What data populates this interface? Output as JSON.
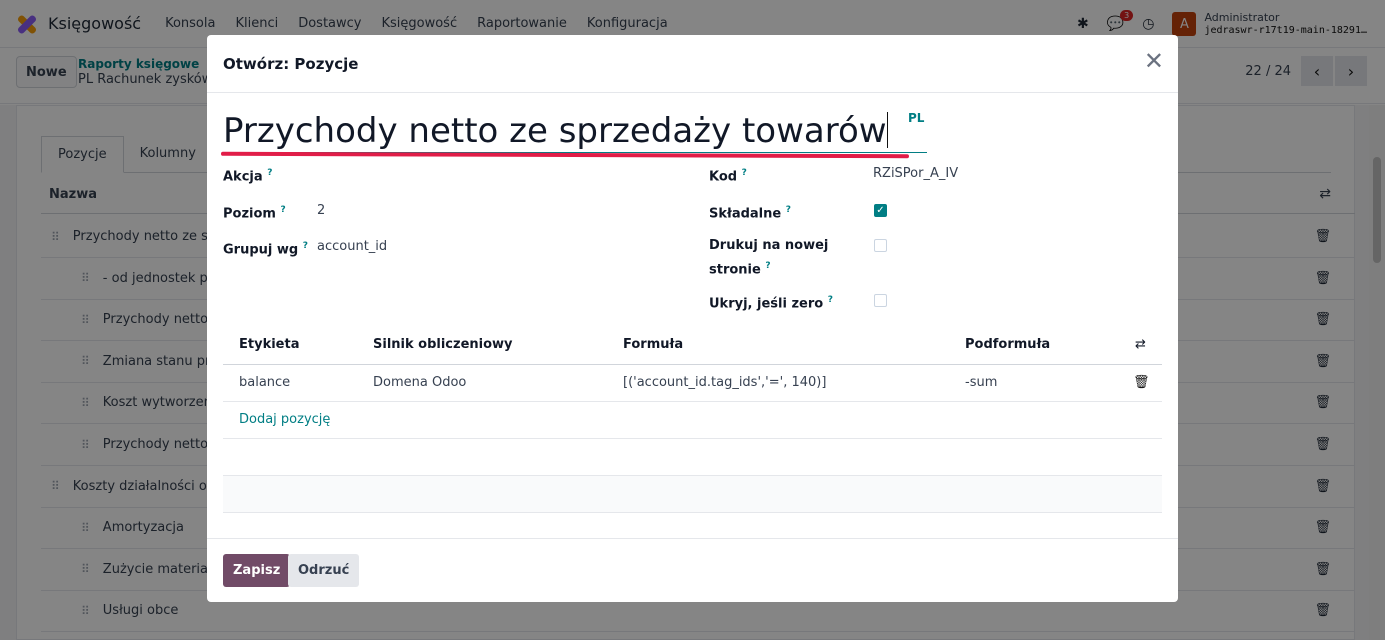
{
  "navbar": {
    "app_name": "Księgowość",
    "menu": [
      "Konsola",
      "Klienci",
      "Dostawcy",
      "Księgowość",
      "Raportowanie",
      "Konfiguracja"
    ],
    "messages_badge": "3",
    "avatar_letter": "A",
    "user_name": "Administrator",
    "db_name": "jedraswr-r17t19-main-18291…"
  },
  "control": {
    "new_label": "Nowe",
    "breadcrumb_parent": "Raporty księgowe",
    "breadcrumb_current": "PL Rachunek zysków",
    "pager": "22 / 24"
  },
  "background": {
    "tabs": [
      "Pozycje",
      "Kolumny"
    ],
    "column_name": "Nazwa",
    "rows": [
      {
        "label": "Przychody netto ze sp",
        "level": 1
      },
      {
        "label": "- od jednostek p",
        "level": 2
      },
      {
        "label": "Przychody netto",
        "level": 2
      },
      {
        "label": "Zmiana stanu pr",
        "level": 2
      },
      {
        "label": "Koszt wytworzen",
        "level": 2
      },
      {
        "label": "Przychody netto",
        "level": 2
      },
      {
        "label": "Koszty działalności op",
        "level": 1
      },
      {
        "label": "Amortyzacja",
        "level": 2
      },
      {
        "label": "Zużycie materia",
        "level": 2
      },
      {
        "label": "Usługi obce",
        "level": 2
      }
    ]
  },
  "modal": {
    "title": "Otwórz: Pozycje",
    "name_value": "Przychody netto ze sprzedaży towarów",
    "lang": "PL",
    "fields": {
      "akcja_label": "Akcja",
      "poziom_label": "Poziom",
      "poziom_value": "2",
      "grupuj_label": "Grupuj wg",
      "grupuj_value": "account_id",
      "kod_label": "Kod",
      "kod_value": "RZiSPor_A_IV",
      "skladalne_label": "Składalne",
      "skladalne_checked": true,
      "drukuj_label_1": "Drukuj na nowej",
      "drukuj_label_2": "stronie",
      "drukuj_checked": false,
      "ukryj_label": "Ukryj, jeśli zero",
      "ukryj_checked": false,
      "help_mark": "?"
    },
    "lines": {
      "headers": [
        "Etykieta",
        "Silnik obliczeniowy",
        "Formuła",
        "Podformuła"
      ],
      "rows": [
        {
          "etykieta": "balance",
          "silnik": "Domena Odoo",
          "formula": "[('account_id.tag_ids','=', 140)]",
          "podformula": "-sum"
        }
      ],
      "add_label": "Dodaj pozycję"
    },
    "save_label": "Zapisz",
    "discard_label": "Odrzuć"
  }
}
